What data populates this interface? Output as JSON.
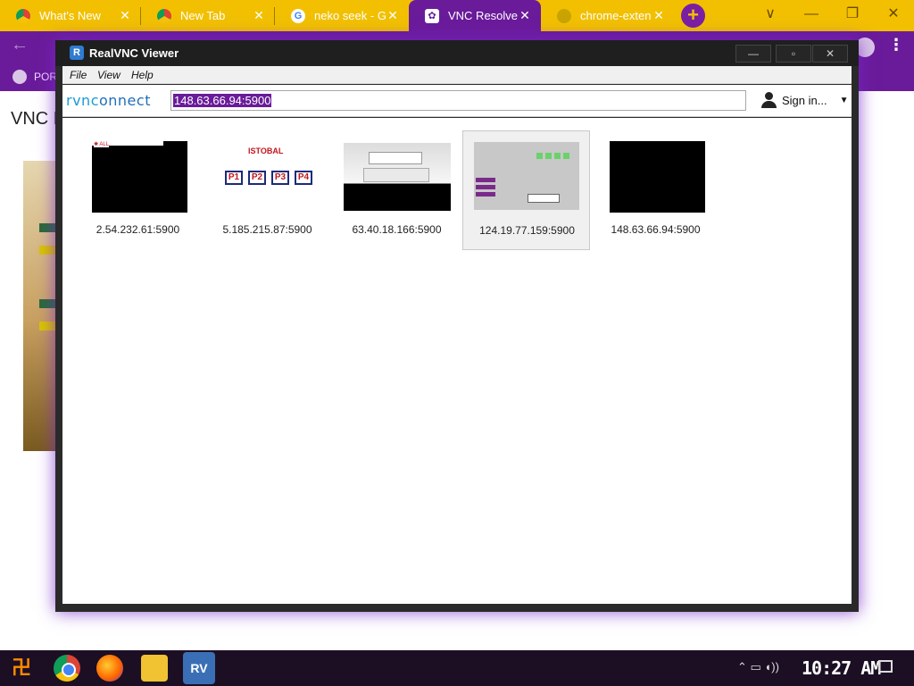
{
  "tabs": [
    {
      "title": "What's New",
      "icon": "chrome-icon"
    },
    {
      "title": "New Tab",
      "icon": "chrome-icon"
    },
    {
      "title": "neko seek - Go",
      "icon": "google-icon"
    },
    {
      "title": "VNC Resolver",
      "icon": "vnc-resolver-icon",
      "active": true
    },
    {
      "title": "chrome-extens",
      "icon": "chrome-icon"
    }
  ],
  "new_tab_label": "+",
  "window_controls": {
    "chevron": "∨",
    "minimize": "—",
    "restore": "❐",
    "close": "✕"
  },
  "bookmarks": {
    "item": "POR"
  },
  "page": {
    "heading": "VNC Re"
  },
  "vnc": {
    "title": "RealVNC Viewer",
    "menus": [
      "File",
      "View",
      "Help"
    ],
    "logo_prefix": "rvnc",
    "logo_suffix": "onnect",
    "address_value": "148.63.66.94:5900",
    "signin_label": "Sign in...",
    "window_buttons": {
      "minimize": "—",
      "maximize": "▫",
      "close": "✕"
    },
    "thumbnails": [
      {
        "label": "2.54.232.61:5900",
        "selected": false
      },
      {
        "label": "5.185.215.87:5900",
        "selected": false,
        "brand": "ISTOBAL",
        "boxes": [
          "P1",
          "P2",
          "P3",
          "P4"
        ]
      },
      {
        "label": "63.40.18.166:5900",
        "selected": false
      },
      {
        "label": "124.19.77.159:5900",
        "selected": true
      },
      {
        "label": "148.63.66.94:5900",
        "selected": false
      }
    ]
  },
  "taskbar": {
    "clock": "10:27 AM",
    "apps": [
      "start-icon",
      "chrome-icon",
      "firefox-icon",
      "files-icon",
      "realvnc-icon"
    ]
  },
  "colors": {
    "tabstrip": "#f2c000",
    "accent": "#6a1b9a",
    "selection": "#6a1b9a"
  }
}
